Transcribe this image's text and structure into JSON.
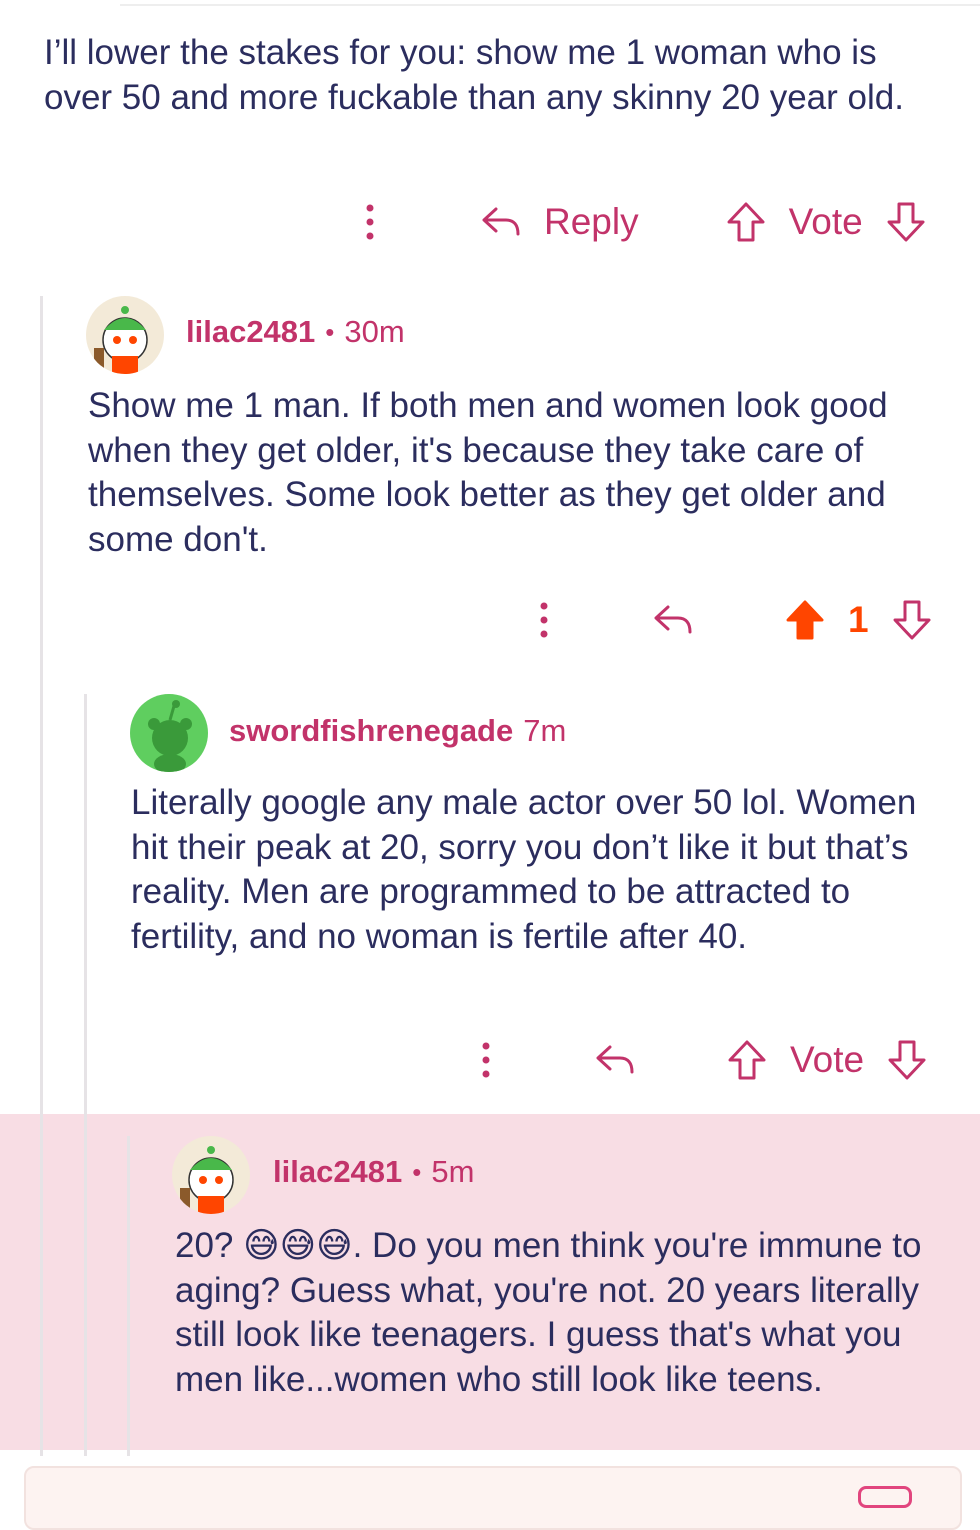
{
  "colors": {
    "accent": "#c2336a",
    "upvoted": "#ff4500",
    "highlight_bg": "#f8dde4",
    "text": "#2b2d5e"
  },
  "comments": [
    {
      "body": "I’ll lower the stakes for you: show me 1 woman who is over 50 and more fuckable than any skinny 20 year old.",
      "reply_label": "Reply",
      "vote_label": "Vote"
    },
    {
      "username": "lilac2481",
      "separator": "•",
      "time": "30m",
      "body": "Show me 1 man. If both men and women look good when they get older, it's because they take care of themselves. Some look better as they get older and some don't.",
      "vote_count": "1",
      "upvoted": true
    },
    {
      "username": "swordfishrenegade",
      "time": "7m",
      "body": "Literally google any male actor over 50 lol. Women hit their peak at 20, sorry you don’t like it but that’s reality. Men are programmed to be attracted to fertility, and no woman is fertile after 40.",
      "vote_label": "Vote"
    },
    {
      "username": "lilac2481",
      "separator": "•",
      "time": "5m",
      "body_prefix": "20? ",
      "emojis": "😅😅😅",
      "body": ". Do you men think you're immune to aging? Guess what, you're not. 20 years literally still look like teenagers. I guess that's what you men like...women who still look like teens.",
      "highlighted": true
    }
  ]
}
